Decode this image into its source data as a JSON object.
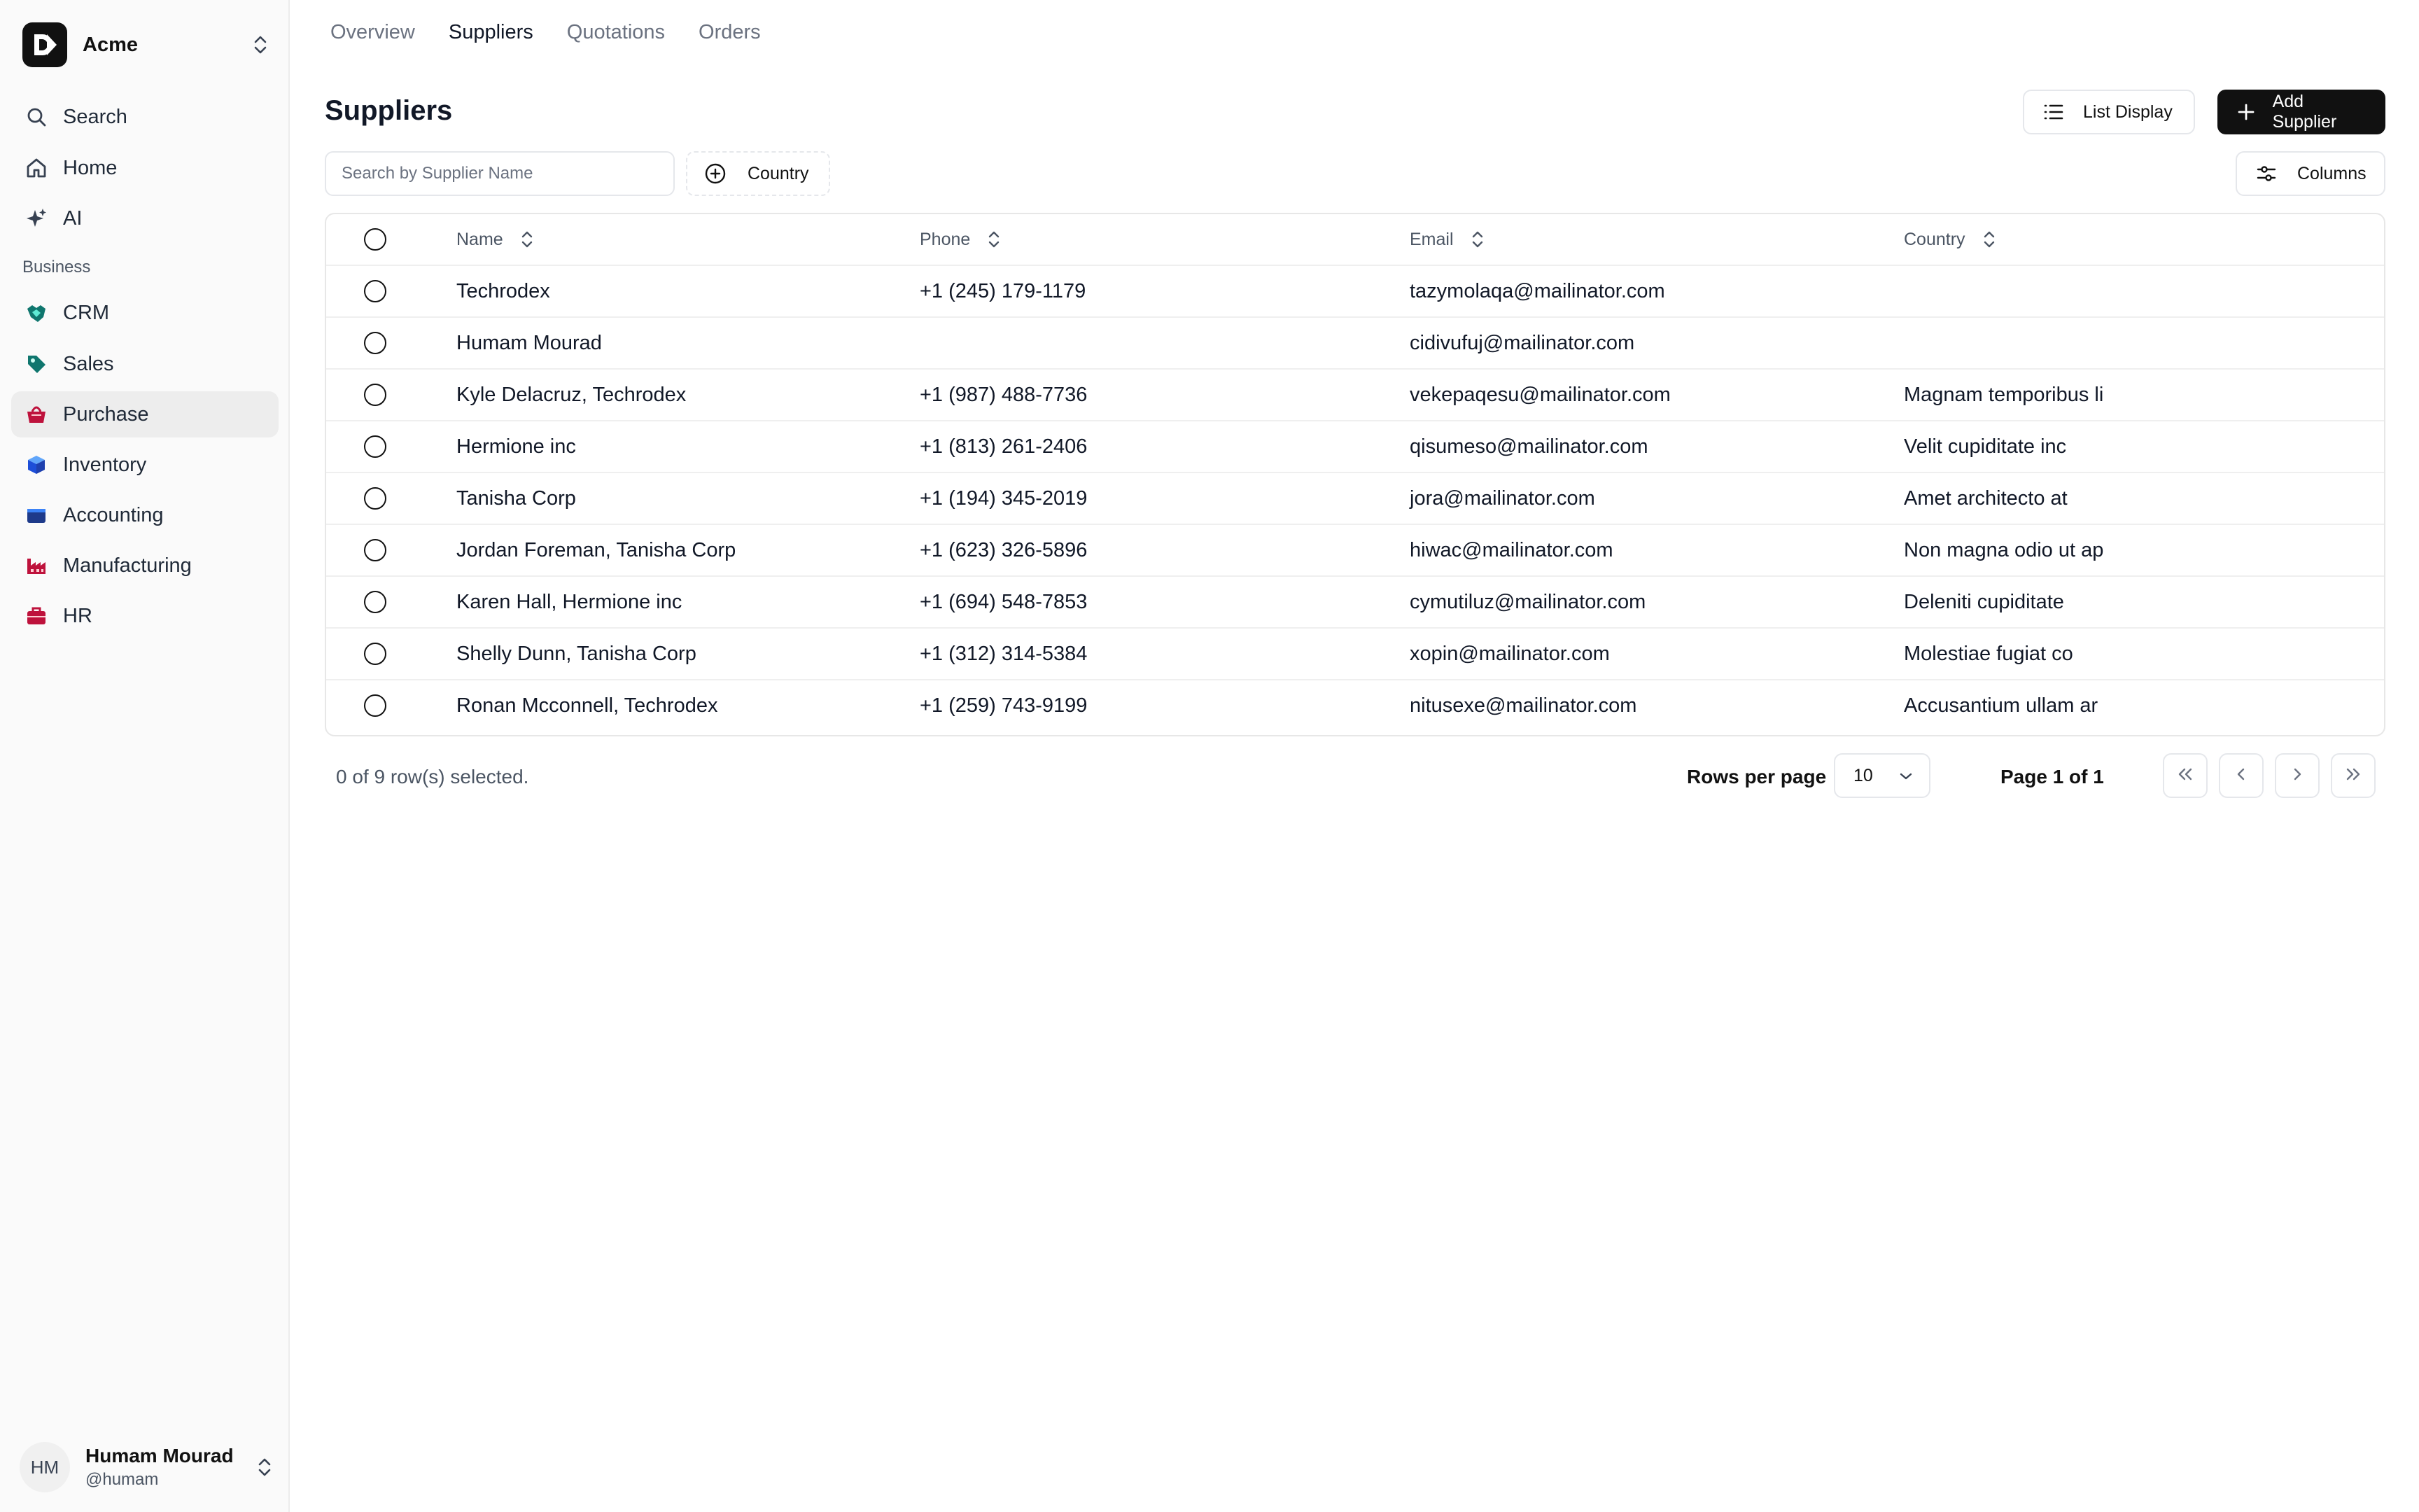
{
  "app": {
    "name": "Acme"
  },
  "sidebar": {
    "top_items": [
      {
        "label": "Search",
        "icon": "search-icon"
      },
      {
        "label": "Home",
        "icon": "home-icon"
      },
      {
        "label": "AI",
        "icon": "sparkles-icon"
      }
    ],
    "section_label": "Business",
    "business_items": [
      {
        "label": "CRM",
        "icon": "handshake-icon",
        "color": "#0f766e"
      },
      {
        "label": "Sales",
        "icon": "tag-icon",
        "color": "#0f766e"
      },
      {
        "label": "Purchase",
        "icon": "basket-icon",
        "color": "#be123c",
        "active": true
      },
      {
        "label": "Inventory",
        "icon": "boxes-icon",
        "color": "#1d4ed8"
      },
      {
        "label": "Accounting",
        "icon": "wallet-icon",
        "color": "#1e3a8a"
      },
      {
        "label": "Manufacturing",
        "icon": "factory-icon",
        "color": "#be123c"
      },
      {
        "label": "HR",
        "icon": "briefcase-icon",
        "color": "#be123c"
      }
    ],
    "user": {
      "initials": "HM",
      "name": "Humam Mourad",
      "handle": "@humam"
    }
  },
  "tabs": [
    {
      "label": "Overview",
      "active": false
    },
    {
      "label": "Suppliers",
      "active": true
    },
    {
      "label": "Quotations",
      "active": false
    },
    {
      "label": "Orders",
      "active": false
    }
  ],
  "header": {
    "title": "Suppliers",
    "list_display_label": "List Display",
    "add_label": "Add Supplier",
    "columns_label": "Columns"
  },
  "filters": {
    "search_placeholder": "Search by Supplier Name",
    "country_label": "Country"
  },
  "table": {
    "columns": [
      "Name",
      "Phone",
      "Email",
      "Country"
    ],
    "rows": [
      {
        "name": "Techrodex",
        "phone": "+1 (245) 179-1179",
        "email": "tazymolaqa@mailinator.com",
        "country": ""
      },
      {
        "name": "Humam Mourad",
        "phone": "",
        "email": "cidivufuj@mailinator.com",
        "country": ""
      },
      {
        "name": "Kyle Delacruz, Techrodex",
        "phone": "+1 (987) 488-7736",
        "email": "vekepaqesu@mailinator.com",
        "country": "Magnam temporibus li"
      },
      {
        "name": "Hermione inc",
        "phone": "+1 (813) 261-2406",
        "email": "qisumeso@mailinator.com",
        "country": "Velit cupiditate inc"
      },
      {
        "name": "Tanisha Corp",
        "phone": "+1 (194) 345-2019",
        "email": "jora@mailinator.com",
        "country": "Amet architecto at"
      },
      {
        "name": "Jordan Foreman, Tanisha Corp",
        "phone": "+1 (623) 326-5896",
        "email": "hiwac@mailinator.com",
        "country": "Non magna odio ut ap"
      },
      {
        "name": "Karen Hall, Hermione inc",
        "phone": "+1 (694) 548-7853",
        "email": "cymutiluz@mailinator.com",
        "country": "Deleniti cupiditate"
      },
      {
        "name": "Shelly Dunn, Tanisha Corp",
        "phone": "+1 (312) 314-5384",
        "email": "xopin@mailinator.com",
        "country": "Molestiae fugiat co"
      },
      {
        "name": "Ronan Mcconnell, Techrodex",
        "phone": "+1 (259) 743-9199",
        "email": "nitusexe@mailinator.com",
        "country": "Accusantium ullam ar"
      }
    ]
  },
  "footer": {
    "selected_text": "0 of 9 row(s) selected.",
    "rows_per_page_label": "Rows per page",
    "rows_per_page_value": "10",
    "page_text": "Page 1 of 1"
  },
  "colors": {
    "primary": "#111111",
    "border": "#e5e7eb",
    "active_nav_bg": "#ededed"
  }
}
